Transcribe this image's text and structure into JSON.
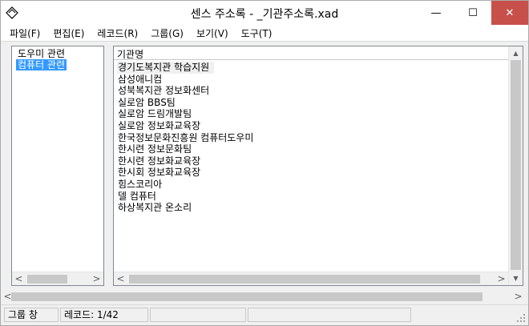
{
  "window": {
    "title": "센스 주소록 - _기관주소록.xad",
    "minimize_glyph": "—",
    "maximize_glyph": "☐",
    "close_glyph": "✕",
    "icon": "diamond-app-icon"
  },
  "menu": [
    "파일(F)",
    "편집(E)",
    "레코드(R)",
    "그룹(G)",
    "보기(V)",
    "도구(T)"
  ],
  "tree": {
    "items": [
      {
        "label": "도우미 관련",
        "selected": false
      },
      {
        "label": "컴퓨터 관련",
        "selected": true
      }
    ]
  },
  "list": {
    "column_header": "기관명",
    "rows": [
      "경기도복지관 학습지원",
      "삼성애니컴",
      "성북복지관 정보화센터",
      "실로암 BBS팀",
      "실로암 드림개발팀",
      "실로암 정보화교육장",
      "한국정보문화진흥원 컴퓨터도우미",
      "한시련 정보문화팀",
      "한시련 정보화교육장",
      "한시회 정보화교육장",
      "힘스코리아",
      "델 컴퓨터",
      "하상복지관 온소리"
    ]
  },
  "scroll": {
    "up": "▲",
    "down": "▼",
    "left": "<",
    "right": ">"
  },
  "status": {
    "pane": "그룹 창",
    "record": "레코드: 1/42"
  },
  "colors": {
    "selection": "#3399ff",
    "close_button": "#c7504b"
  }
}
